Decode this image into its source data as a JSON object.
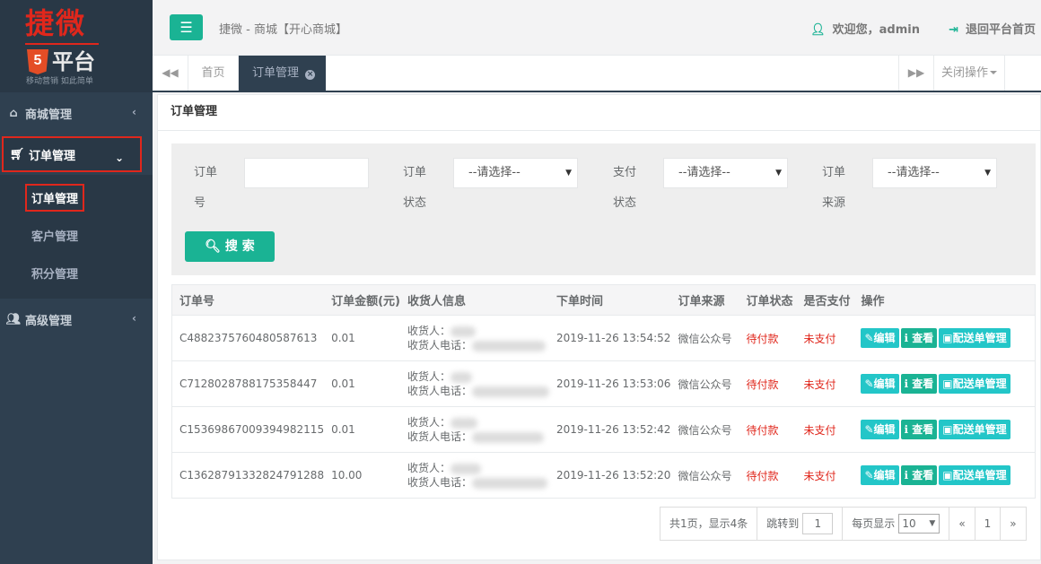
{
  "logo": {
    "top": "捷微",
    "badge": "5",
    "mid": "平台",
    "slogan": "移动营销 如此简单"
  },
  "sidebar": {
    "items": [
      {
        "label": "商城管理",
        "icon": "home-icon"
      },
      {
        "label": "订单管理",
        "icon": "cart-icon"
      },
      {
        "label": "高级管理",
        "icon": "users-icon"
      }
    ],
    "sub_items": [
      "订单管理",
      "客户管理",
      "积分管理"
    ]
  },
  "header": {
    "site_title": "捷微 - 商城【开心商城】",
    "welcome": "欢迎您，admin",
    "logout": "退回平台首页"
  },
  "tabs": {
    "home": "首页",
    "active": "订单管理",
    "close_ops": "关闭操作"
  },
  "panel": {
    "title": "订单管理"
  },
  "search": {
    "order_no_label": "订单号",
    "order_status_label": "订单状态",
    "pay_status_label": "支付状态",
    "order_source_label": "订单来源",
    "select_placeholder": "--请选择--",
    "button": "搜 索"
  },
  "table": {
    "headers": [
      "订单号",
      "订单金额(元)",
      "收货人信息",
      "下单时间",
      "订单来源",
      "订单状态",
      "是否支付",
      "操作"
    ],
    "receiver_label": "收货人：",
    "phone_label": "收货人电话：",
    "actions": {
      "edit": "编辑",
      "view": "查看",
      "ship": "配送单管理"
    },
    "rows": [
      {
        "order_no": "C4882375760480587613",
        "amount": "0.01",
        "time": "2019-11-26 13:54:52",
        "source": "微信公众号",
        "status": "待付款",
        "paid": "未支付"
      },
      {
        "order_no": "C7128028788175358447",
        "amount": "0.01",
        "time": "2019-11-26 13:53:06",
        "source": "微信公众号",
        "status": "待付款",
        "paid": "未支付"
      },
      {
        "order_no": "C15369867009394982115",
        "amount": "0.01",
        "time": "2019-11-26 13:52:42",
        "source": "微信公众号",
        "status": "待付款",
        "paid": "未支付"
      },
      {
        "order_no": "C13628791332824791288",
        "amount": "10.00",
        "time": "2019-11-26 13:52:20",
        "source": "微信公众号",
        "status": "待付款",
        "paid": "未支付"
      }
    ]
  },
  "pagination": {
    "summary": "共1页，显示4条",
    "jump_label": "跳转到",
    "jump_value": "1",
    "per_page_label": "每页显示",
    "per_page_value": "10",
    "prev": "«",
    "current": "1",
    "next": "»"
  },
  "colors": {
    "primary": "#1ab394",
    "info": "#23c6c8",
    "sidebar": "#2f4050",
    "danger": "#e0271c"
  }
}
